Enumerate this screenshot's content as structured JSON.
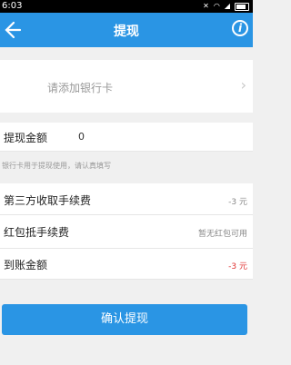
{
  "status_bar": {
    "time": "6:03"
  },
  "header": {
    "title": "提现",
    "back_icon": "arrow-left-icon",
    "info_icon": "info-icon",
    "info_glyph": "i"
  },
  "bank_card": {
    "label": "请添加银行卡",
    "chevron": "›"
  },
  "amount": {
    "label": "提现金额",
    "value": "0"
  },
  "note": "银行卡用于提现使用，请认真填写",
  "fees": {
    "third_party_label": "第三方收取手续费",
    "third_party_value": "-3 元",
    "red_packet_label": "红包抵手续费",
    "red_packet_value": "暂无红包可用",
    "net_label": "到账金额",
    "net_value": "-3 元"
  },
  "confirm_button": "确认提现",
  "colors": {
    "primary": "#2a95e4",
    "negative": "#e03030"
  }
}
